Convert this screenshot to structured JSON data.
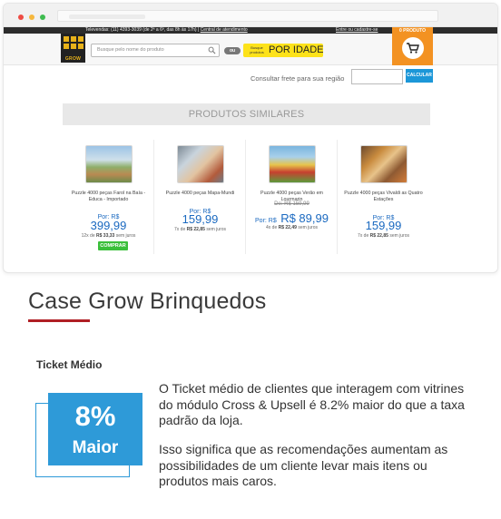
{
  "store": {
    "phone_text": "Televendas: (11) 4393-3039 (de 2ª a 6ª, das 8h às 17h) |",
    "support_link": "Central de atendimento",
    "login_link": "Entre ou cadastre-se",
    "logo_text": "GROW",
    "search_placeholder": "Busque pelo nome do produto",
    "ou_label": "ou",
    "idade_small": "Busque produtos",
    "idade_label": "POR IDADE",
    "cart_label": "0 PRODUTO"
  },
  "freight": {
    "label": "Consultar frete para sua região",
    "button": "CALCULAR"
  },
  "similares_title": "PRODUTOS SIMILARES",
  "products": [
    {
      "name": "Puzzle 4000 peças Farol na Baía - Educa - Importado",
      "por": "Por: R$",
      "price": "399,99",
      "inst_prefix": "12x de",
      "inst_value": "R$ 33,33",
      "inst_suffix": "sem juros",
      "buy": "COMPRAR"
    },
    {
      "name": "Puzzle 4000 peças Mapa-Mundi",
      "por": "Por: R$",
      "price": "159,99",
      "inst_prefix": "7x de",
      "inst_value": "R$ 22,85",
      "inst_suffix": "sem juros"
    },
    {
      "name": "Puzzle 4000 peças Verão em Lourmarin",
      "de": "De: R$ 159,99",
      "por": "Por: R$",
      "price": "R$ 89,99",
      "inst_prefix": "4x de",
      "inst_value": "R$ 22,49",
      "inst_suffix": "sem juros"
    },
    {
      "name": "Puzzle 4000 peças Vivaldi as Quatro Estações",
      "por": "Por: R$",
      "price": "159,99",
      "inst_prefix": "7x de",
      "inst_value": "R$ 22,85",
      "inst_suffix": "sem juros"
    }
  ],
  "case": {
    "title": "Case Grow Brinquedos",
    "ticket_label": "Ticket Médio",
    "stat_value": "8%",
    "stat_word": "Maior",
    "paragraph1": "O Ticket médio de clientes que interagem com vitrines do módulo Cross & Upsell é 8.2% maior do que a taxa padrão da loja.",
    "paragraph2": "Isso significa que as recomendações aumentam as possibilidades de um cliente levar mais itens ou produtos mais caros."
  },
  "colors": {
    "accent_blue": "#2e9ad8",
    "accent_red": "#b01f24",
    "price_blue": "#1a69c0",
    "cart_orange": "#f39222",
    "idade_yellow": "#fde21a"
  }
}
